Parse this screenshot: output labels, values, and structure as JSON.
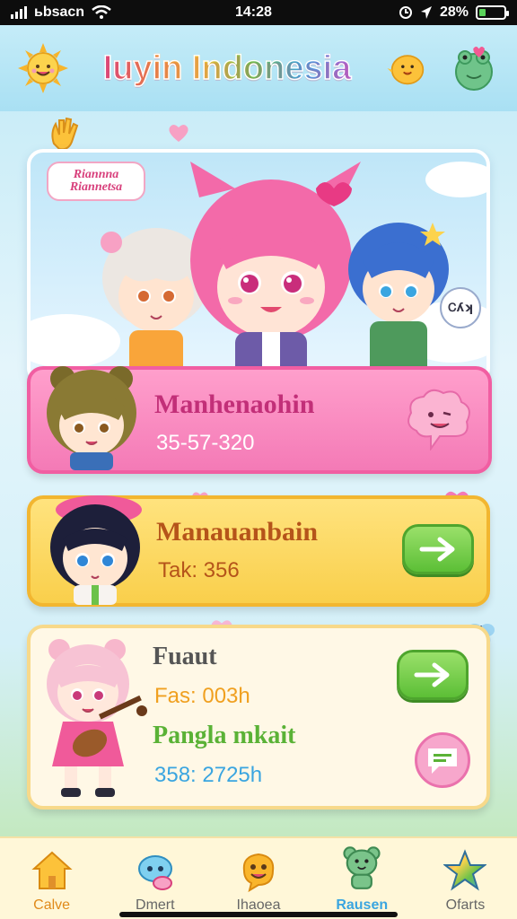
{
  "status_bar": {
    "carrier": "ьbsacn",
    "time": "14:28",
    "battery": "28%",
    "battery_level": 0.28
  },
  "header": {
    "title": "Iuyin Indonesia",
    "left_icon": "sun-mascot-icon",
    "right_icons": [
      "chick-mascot-icon",
      "frog-mascot-icon"
    ]
  },
  "hero": {
    "badge": "Riannna Riannetsa",
    "speech": "Ꮯʎʞ"
  },
  "cards": [
    {
      "title": "Manhenaohin",
      "subtitle": "35-57-320",
      "action_icon": "cloud-wink-icon"
    },
    {
      "title": "Manauanbain",
      "subtitle": "Tak: 356",
      "action_icon": "arrow-right-icon"
    },
    {
      "title": "Fuaut",
      "subtitle": "Fas: 003h",
      "title2": "Pangla mkait",
      "subtitle2": "358: 2725h",
      "action_icon": "arrow-right-icon",
      "action2_icon": "chat-bubble-icon"
    }
  ],
  "nav": {
    "items": [
      {
        "label": "Calve",
        "icon": "house-icon",
        "active": false
      },
      {
        "label": "Dmert",
        "icon": "chat-blob-icon",
        "active": false
      },
      {
        "label": "Ihaoea",
        "icon": "smile-blob-icon",
        "active": false
      },
      {
        "label": "Rausen",
        "icon": "bear-icon",
        "active": true
      },
      {
        "label": "Ofarts",
        "icon": "star-icon",
        "active": false
      }
    ]
  },
  "colors": {
    "pink_card": "#f47ab6",
    "yellow_card": "#f9cf4b",
    "cream_card": "#fff8e6",
    "green_button": "#5cbf36",
    "accent_blue": "#3aa5e0"
  }
}
